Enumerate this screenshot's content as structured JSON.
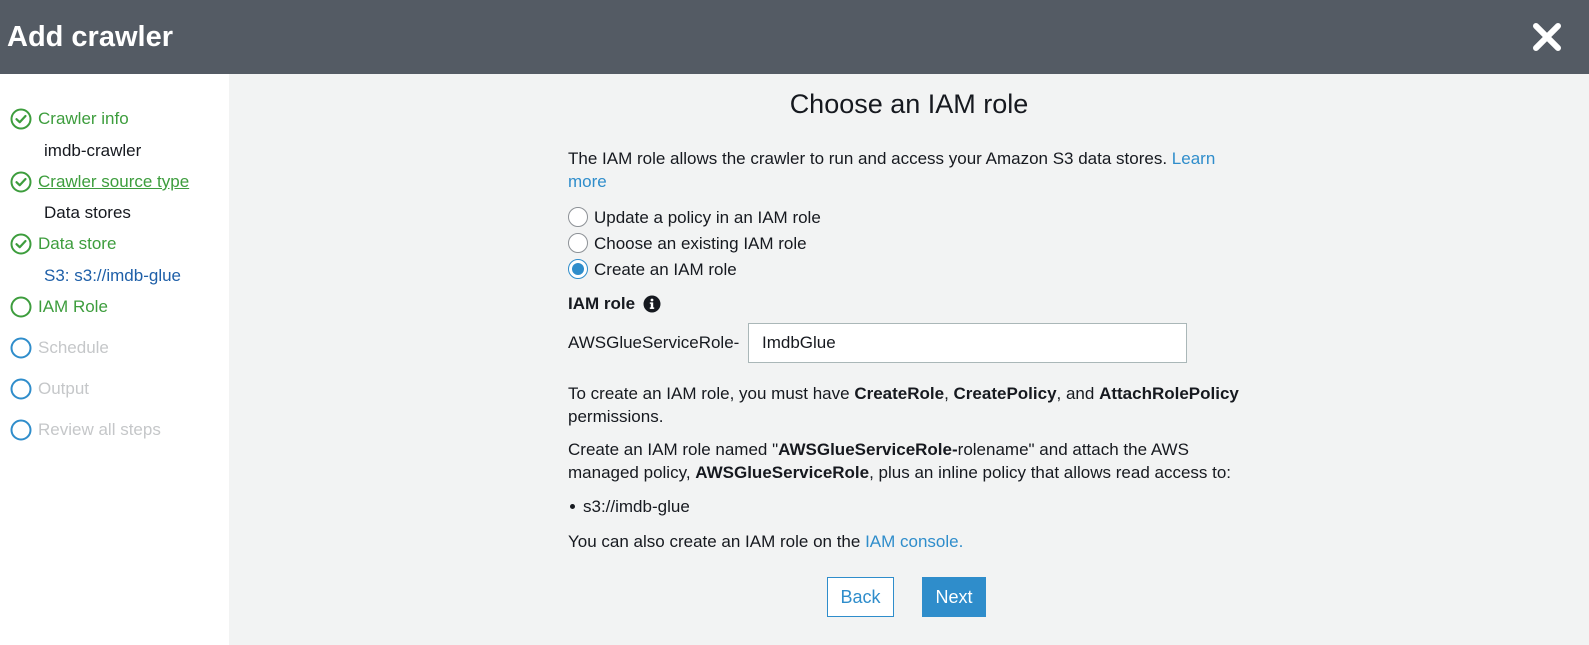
{
  "header": {
    "title": "Add crawler",
    "close_icon": "close-icon"
  },
  "sidebar": {
    "steps": [
      {
        "label": "Crawler info",
        "status": "done",
        "sublabel": "imdb-crawler"
      },
      {
        "label": "Crawler source type",
        "status": "done",
        "sublabel": "Data stores"
      },
      {
        "label": "Data store",
        "status": "done",
        "sublabel": "S3: s3://imdb-glue"
      },
      {
        "label": "IAM Role",
        "status": "current"
      },
      {
        "label": "Schedule",
        "status": "todo"
      },
      {
        "label": "Output",
        "status": "todo"
      },
      {
        "label": "Review all steps",
        "status": "todo"
      }
    ]
  },
  "main": {
    "title": "Choose an IAM role",
    "intro_text": "The IAM role allows the crawler to run and access your Amazon S3 data stores.",
    "learn_more": "Learn more",
    "radio_options": [
      {
        "label": "Update a policy in an IAM role",
        "checked": false
      },
      {
        "label": "Choose an existing IAM role",
        "checked": false
      },
      {
        "label": "Create an IAM role",
        "checked": true
      }
    ],
    "iam_role_label": "IAM role",
    "role_prefix": "AWSGlueServiceRole-",
    "role_value": "ImdbGlue",
    "permissions_text": {
      "before": "To create an IAM role, you must have ",
      "p1": "CreateRole",
      "sep1": ", ",
      "p2": "CreatePolicy",
      "sep2": ", and ",
      "p3": "AttachRolePolicy",
      "after": " permissions."
    },
    "create_text": {
      "before": "Create an IAM role named \"",
      "bold1": "AWSGlueServiceRole-",
      "middle1": "rolename\" and attach the AWS managed policy, ",
      "bold2": "AWSGlueServiceRole",
      "after": ", plus an inline policy that allows read access to:"
    },
    "access_bullet": "s3://imdb-glue",
    "console_text": "You can also create an IAM role on the ",
    "console_link": "IAM console.",
    "back_label": "Back",
    "next_label": "Next"
  },
  "colors": {
    "header_bg": "#545b64",
    "accent": "#2f8dcb",
    "done_green": "#3d9d3d",
    "todo_gray": "#c5c7c9"
  }
}
